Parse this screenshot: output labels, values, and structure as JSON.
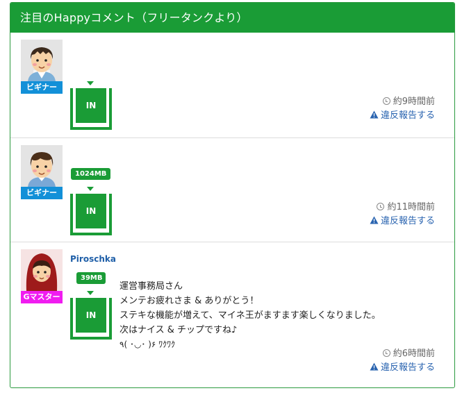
{
  "panel": {
    "title": "注目のHappyコメント（フリータンクより）"
  },
  "comments": [
    {
      "rank": "ビギナー",
      "rank_color": "#1290d8",
      "avatar_icon": "beginner-man-avatar-icon",
      "username": "",
      "size": "",
      "in_label": "IN",
      "text_lines": [],
      "time": "約9時間前",
      "report": "違反報告する"
    },
    {
      "rank": "ビギナー",
      "rank_color": "#1290d8",
      "avatar_icon": "beginner-boy-avatar-icon",
      "username": "",
      "size": "1024MB",
      "in_label": "IN",
      "text_lines": [],
      "time": "約11時間前",
      "report": "違反報告する"
    },
    {
      "rank": "Gマスター",
      "rank_color": "#f01cf0",
      "avatar_icon": "gmaster-red-hood-avatar-icon",
      "username": "Piroschka",
      "size": "39MB",
      "in_label": "IN",
      "text_lines": [
        "運営事務局さん",
        "メンテお疲れさま & ありがとう！",
        "ステキな機能が増えて、マイネ王がますます楽しくなりました。",
        "次はナイス & チップですね♪",
        "٩( ･◡･ )۶ ﾜｸﾜｸ"
      ],
      "time": "約6時間前",
      "report": "違反報告する"
    }
  ],
  "colors": {
    "header_green": "#1a9c36",
    "link_blue": "#2a64b0",
    "username_blue": "#1f5fa8"
  }
}
